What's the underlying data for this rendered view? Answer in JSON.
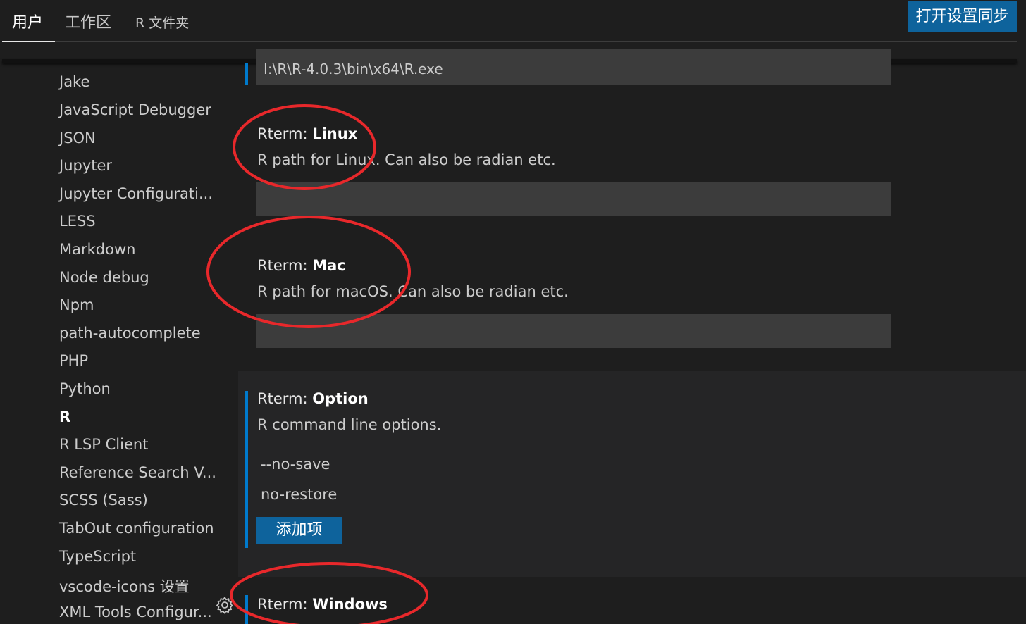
{
  "tabs": [
    {
      "label": "用户"
    },
    {
      "label": "工作区"
    },
    {
      "label": "R 文件夹"
    }
  ],
  "sync_button": "打开设置同步",
  "toc": {
    "items": [
      {
        "label": "Jake"
      },
      {
        "label": "JavaScript Debugger"
      },
      {
        "label": "JSON"
      },
      {
        "label": "Jupyter"
      },
      {
        "label": "Jupyter Configurati..."
      },
      {
        "label": "LESS"
      },
      {
        "label": "Markdown"
      },
      {
        "label": "Node debug"
      },
      {
        "label": "Npm"
      },
      {
        "label": "path-autocomplete"
      },
      {
        "label": "PHP"
      },
      {
        "label": "Python"
      },
      {
        "label": "R"
      },
      {
        "label": "R LSP Client"
      },
      {
        "label": "Reference Search V..."
      },
      {
        "label": "SCSS (Sass)"
      },
      {
        "label": "TabOut configuration"
      },
      {
        "label": "TypeScript"
      },
      {
        "label": "vscode-icons 设置"
      },
      {
        "label": "XML Tools Configur..."
      }
    ],
    "active": "R"
  },
  "settings": {
    "path_value": "I:\\R\\R-4.0.3\\bin\\x64\\R.exe",
    "linux": {
      "category": "Rterm: ",
      "name": "Linux",
      "description": "R path for Linux. Can also be radian etc.",
      "value": ""
    },
    "mac": {
      "category": "Rterm: ",
      "name": "Mac",
      "description": "R path for macOS. Can also be radian etc.",
      "value": ""
    },
    "option": {
      "category": "Rterm: ",
      "name": "Option",
      "description": "R command line options.",
      "items": [
        "--no-save",
        "no-restore"
      ],
      "add_label": "添加项"
    },
    "windows": {
      "category": "Rterm: ",
      "name": "Windows"
    }
  },
  "colors": {
    "background": "#1e1e1e",
    "accent": "#0e639c",
    "focus": "#007acc",
    "annotation": "#e8282b"
  },
  "icons": {
    "gear": "gear-icon"
  }
}
